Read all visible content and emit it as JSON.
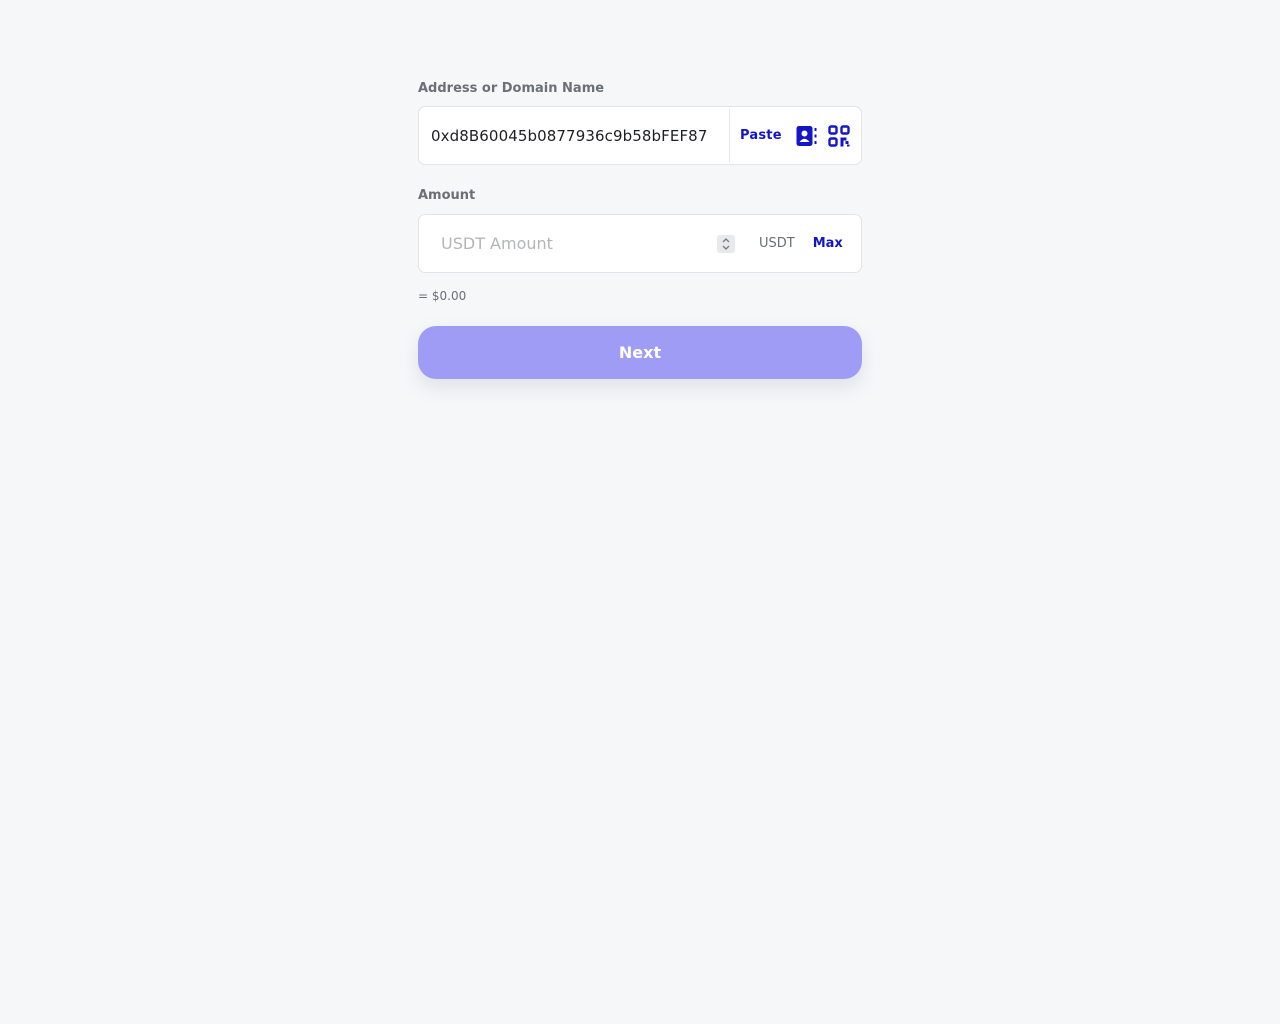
{
  "address_field": {
    "label": "Address or Domain Name",
    "value": "0xd8B60045b0877936c9b58bFEF87",
    "paste_label": "Paste",
    "contacts_icon": "address-book-icon",
    "scan_icon": "qr-code-icon"
  },
  "amount_field": {
    "label": "Amount",
    "placeholder": "USDT Amount",
    "token": "USDT",
    "max_label": "Max",
    "usd_value": "= $0.00"
  },
  "next_button": {
    "label": "Next"
  },
  "colors": {
    "accent": "#1515c8",
    "button": "#9e9cf5",
    "background": "#f6f7f9"
  }
}
